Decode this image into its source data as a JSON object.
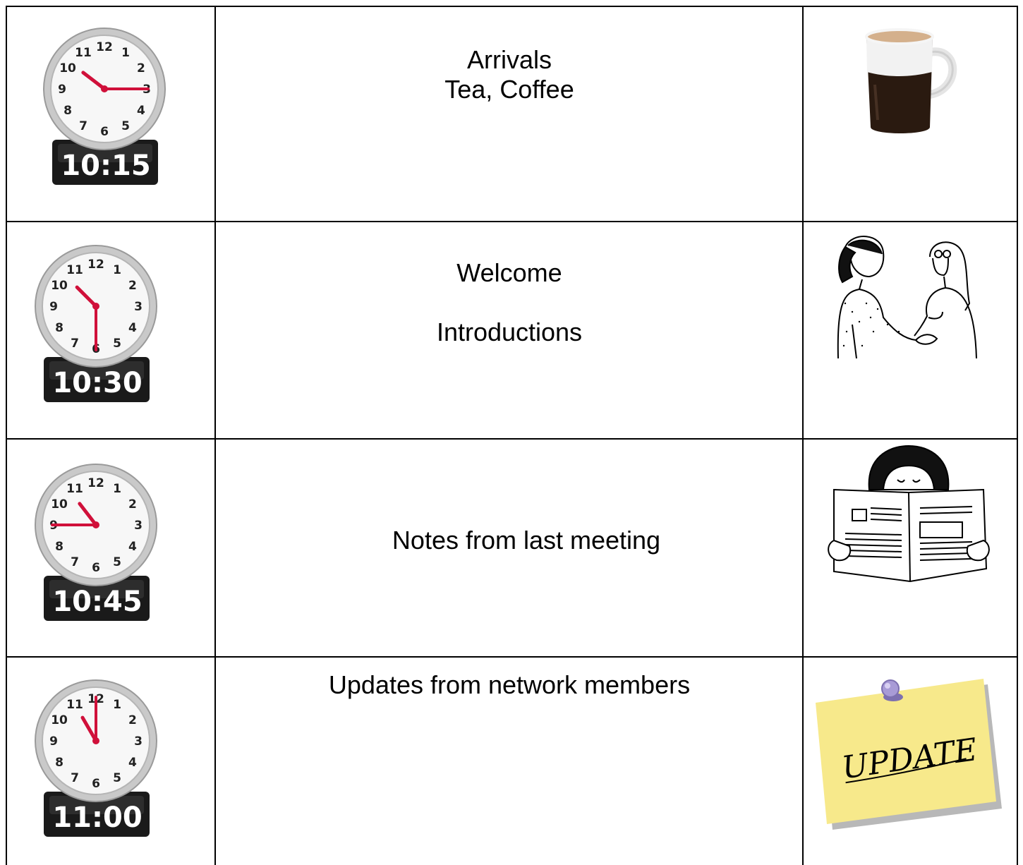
{
  "rows": [
    {
      "time": "10:15",
      "hour_hand_deg": 307.5,
      "minute_hand_deg": 90,
      "lines": [
        "Arrivals",
        "Tea, Coffee"
      ],
      "picture": "coffee-mug"
    },
    {
      "time": "10:30",
      "hour_hand_deg": 315,
      "minute_hand_deg": 180,
      "lines": [
        "Welcome",
        "",
        "Introductions"
      ],
      "picture": "handshake-drawing"
    },
    {
      "time": "10:45",
      "hour_hand_deg": 322.5,
      "minute_hand_deg": 270,
      "lines": [
        "Notes from last meeting"
      ],
      "picture": "reading-newspaper-drawing"
    },
    {
      "time": "11:00",
      "hour_hand_deg": 330,
      "minute_hand_deg": 0,
      "lines": [
        "Updates from network members"
      ],
      "picture": "update-sticky-note"
    }
  ],
  "clock_numbers": [
    "12",
    "1",
    "2",
    "3",
    "4",
    "5",
    "6",
    "7",
    "8",
    "9",
    "10",
    "11"
  ],
  "update_note_text": "UPDATE",
  "colors": {
    "hand": "#d0103a",
    "clock_base": "#1a1a1a",
    "note": "#f7e98b",
    "pin": "#9b8fc9"
  }
}
